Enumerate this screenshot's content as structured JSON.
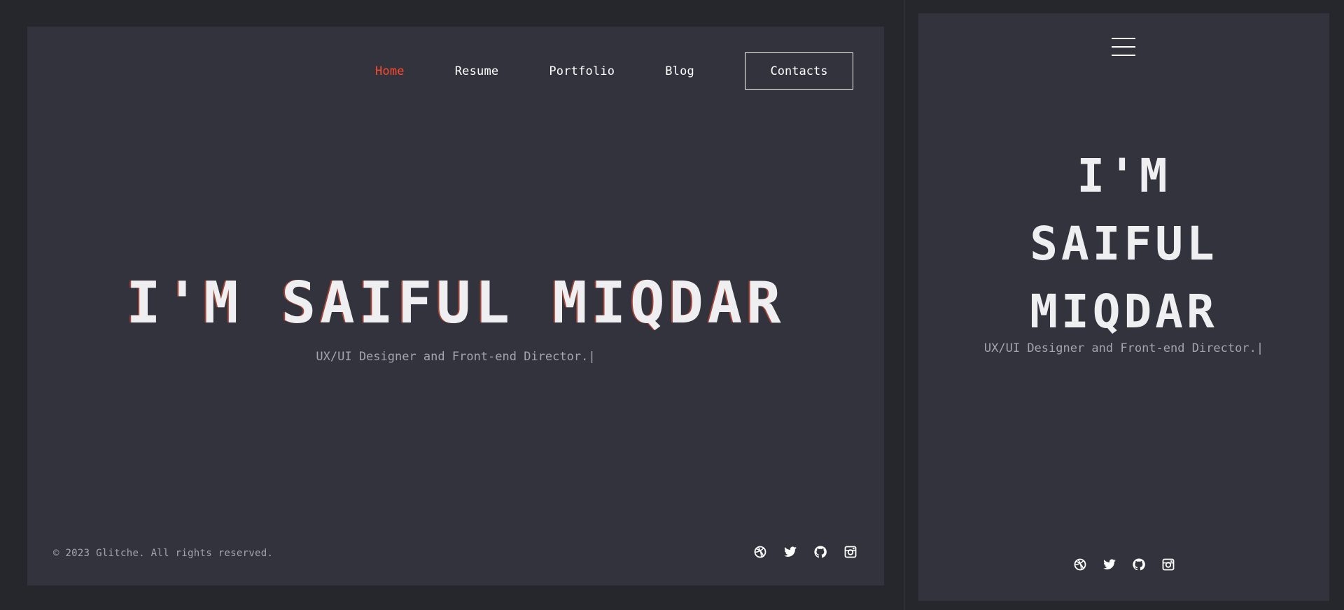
{
  "nav": {
    "items": [
      {
        "label": "Home",
        "active": true
      },
      {
        "label": "Resume"
      },
      {
        "label": "Portfolio"
      },
      {
        "label": "Blog"
      }
    ],
    "contacts_label": "Contacts"
  },
  "hero": {
    "title": "I'M SAIFUL MIQDAR",
    "subtitle": "UX/UI Designer and Front-end Director.|"
  },
  "footer": {
    "copyright": "© 2023 Glitche. All rights reserved."
  },
  "mobile": {
    "title_lines": [
      "I'M",
      "SAIFUL",
      "MIQDAR"
    ],
    "subtitle": "UX/UI Designer and Front-end Director.|"
  },
  "social": [
    "dribbble-icon",
    "twitter-icon",
    "github-icon",
    "instagram-icon"
  ],
  "colors": {
    "accent": "#ff4a2e",
    "panel": "#32333c",
    "background": "#26272d",
    "muted_text": "#a4a5ad"
  }
}
